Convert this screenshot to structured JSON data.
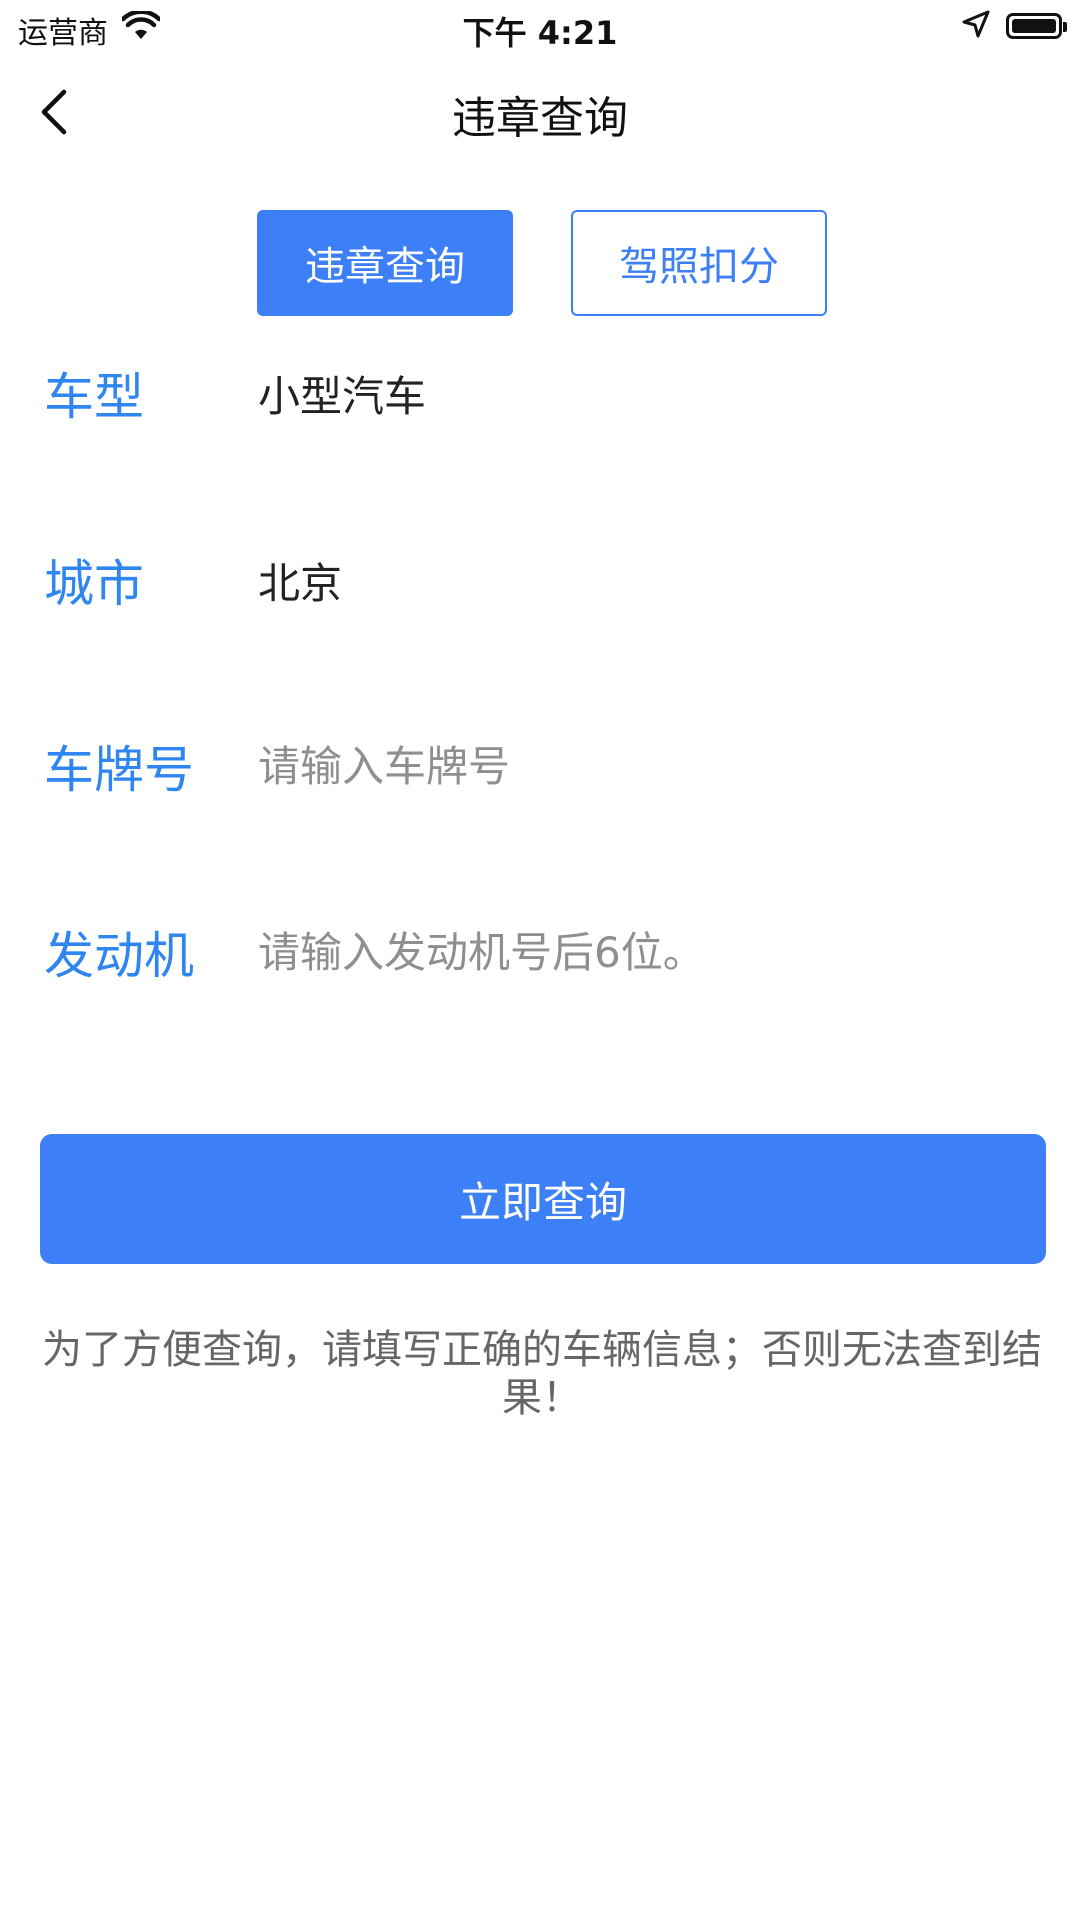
{
  "status_bar": {
    "carrier": "运营商",
    "time": "下午 4:21",
    "icons": [
      "wifi-icon",
      "location-arrow-icon",
      "battery-icon"
    ]
  },
  "nav": {
    "title": "违章查询",
    "back_icon": "chevron-left-icon"
  },
  "tabs": [
    {
      "label": "违章查询",
      "active": true
    },
    {
      "label": "驾照扣分",
      "active": false
    }
  ],
  "form": {
    "car_type": {
      "label": "车型",
      "value": "小型汽车"
    },
    "city": {
      "label": "城市",
      "value": "北京"
    },
    "plate": {
      "label": "车牌号",
      "placeholder": "请输入车牌号",
      "value": ""
    },
    "engine": {
      "label": "发动机",
      "placeholder": "请输入发动机号后6位。",
      "value": ""
    }
  },
  "query_button": {
    "label": "立即查询"
  },
  "notice": "为了方便查询，请填写正确的车辆信息；否则无法查到结果！",
  "colors": {
    "accent": "#3d7ff6",
    "label": "#2f86f0",
    "placeholder": "#8e8e93",
    "notice": "#666666"
  }
}
